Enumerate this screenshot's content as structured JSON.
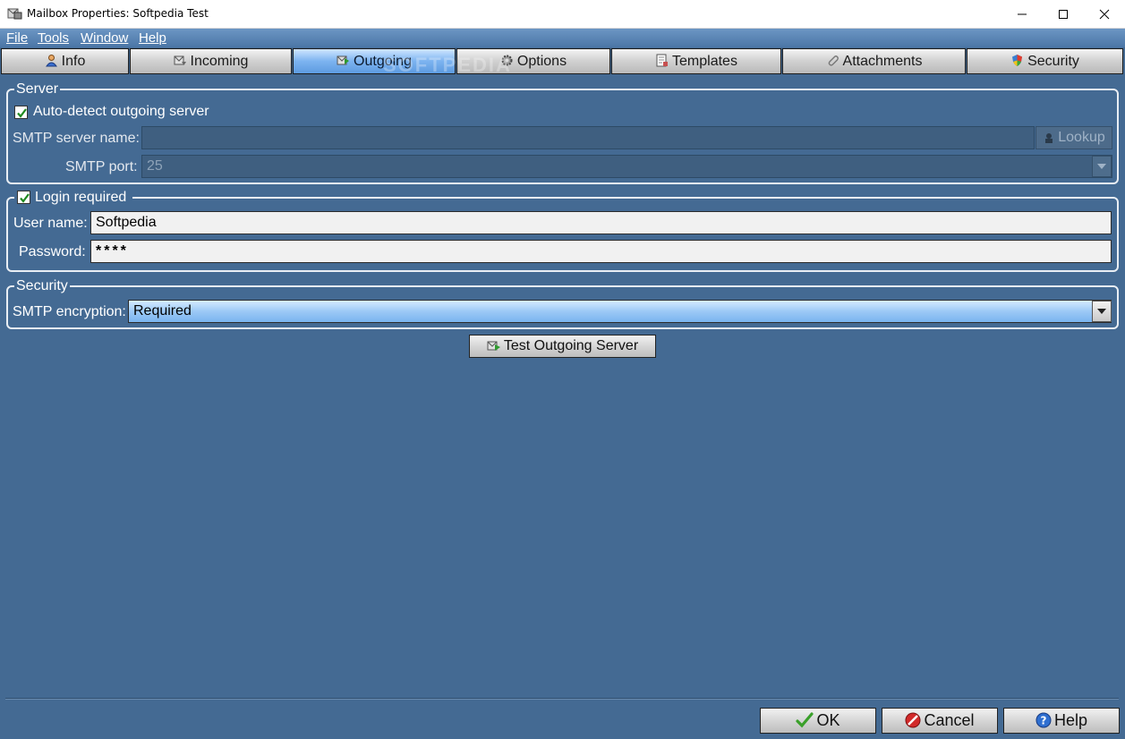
{
  "window": {
    "title": "Mailbox Properties: Softpedia Test"
  },
  "menu": [
    "File",
    "Tools",
    "Window",
    "Help"
  ],
  "tabs": [
    {
      "label": "Info",
      "icon": "user-icon"
    },
    {
      "label": "Incoming",
      "icon": "inbox-icon"
    },
    {
      "label": "Outgoing",
      "icon": "outbox-icon",
      "active": true
    },
    {
      "label": "Options",
      "icon": "gear-icon"
    },
    {
      "label": "Templates",
      "icon": "document-icon"
    },
    {
      "label": "Attachments",
      "icon": "paperclip-icon"
    },
    {
      "label": "Security",
      "icon": "shield-icon"
    }
  ],
  "watermark": "SOFTPEDIA",
  "server": {
    "legend": "Server",
    "autodetect_label": "Auto-detect outgoing server",
    "autodetect_checked": true,
    "smtp_name_label": "SMTP server name:",
    "smtp_name_value": "",
    "lookup_label": "Lookup",
    "smtp_port_label": "SMTP port:",
    "smtp_port_value": "25"
  },
  "login": {
    "legend": "Login required",
    "checked": true,
    "username_label": "User name:",
    "username_value": "Softpedia",
    "password_label": "Password:",
    "password_value": "****"
  },
  "security": {
    "legend": "Security",
    "encryption_label": "SMTP encryption:",
    "encryption_value": "Required"
  },
  "test_button_label": "Test Outgoing Server",
  "footer": {
    "ok_label": "OK",
    "cancel_label": "Cancel",
    "help_label": "Help"
  },
  "colors": {
    "background": "#446a93",
    "active_tab": "#7cb3f0",
    "ok_check": "#3aa02a",
    "cancel_red": "#d22a2a",
    "help_blue": "#2f6fd0"
  }
}
